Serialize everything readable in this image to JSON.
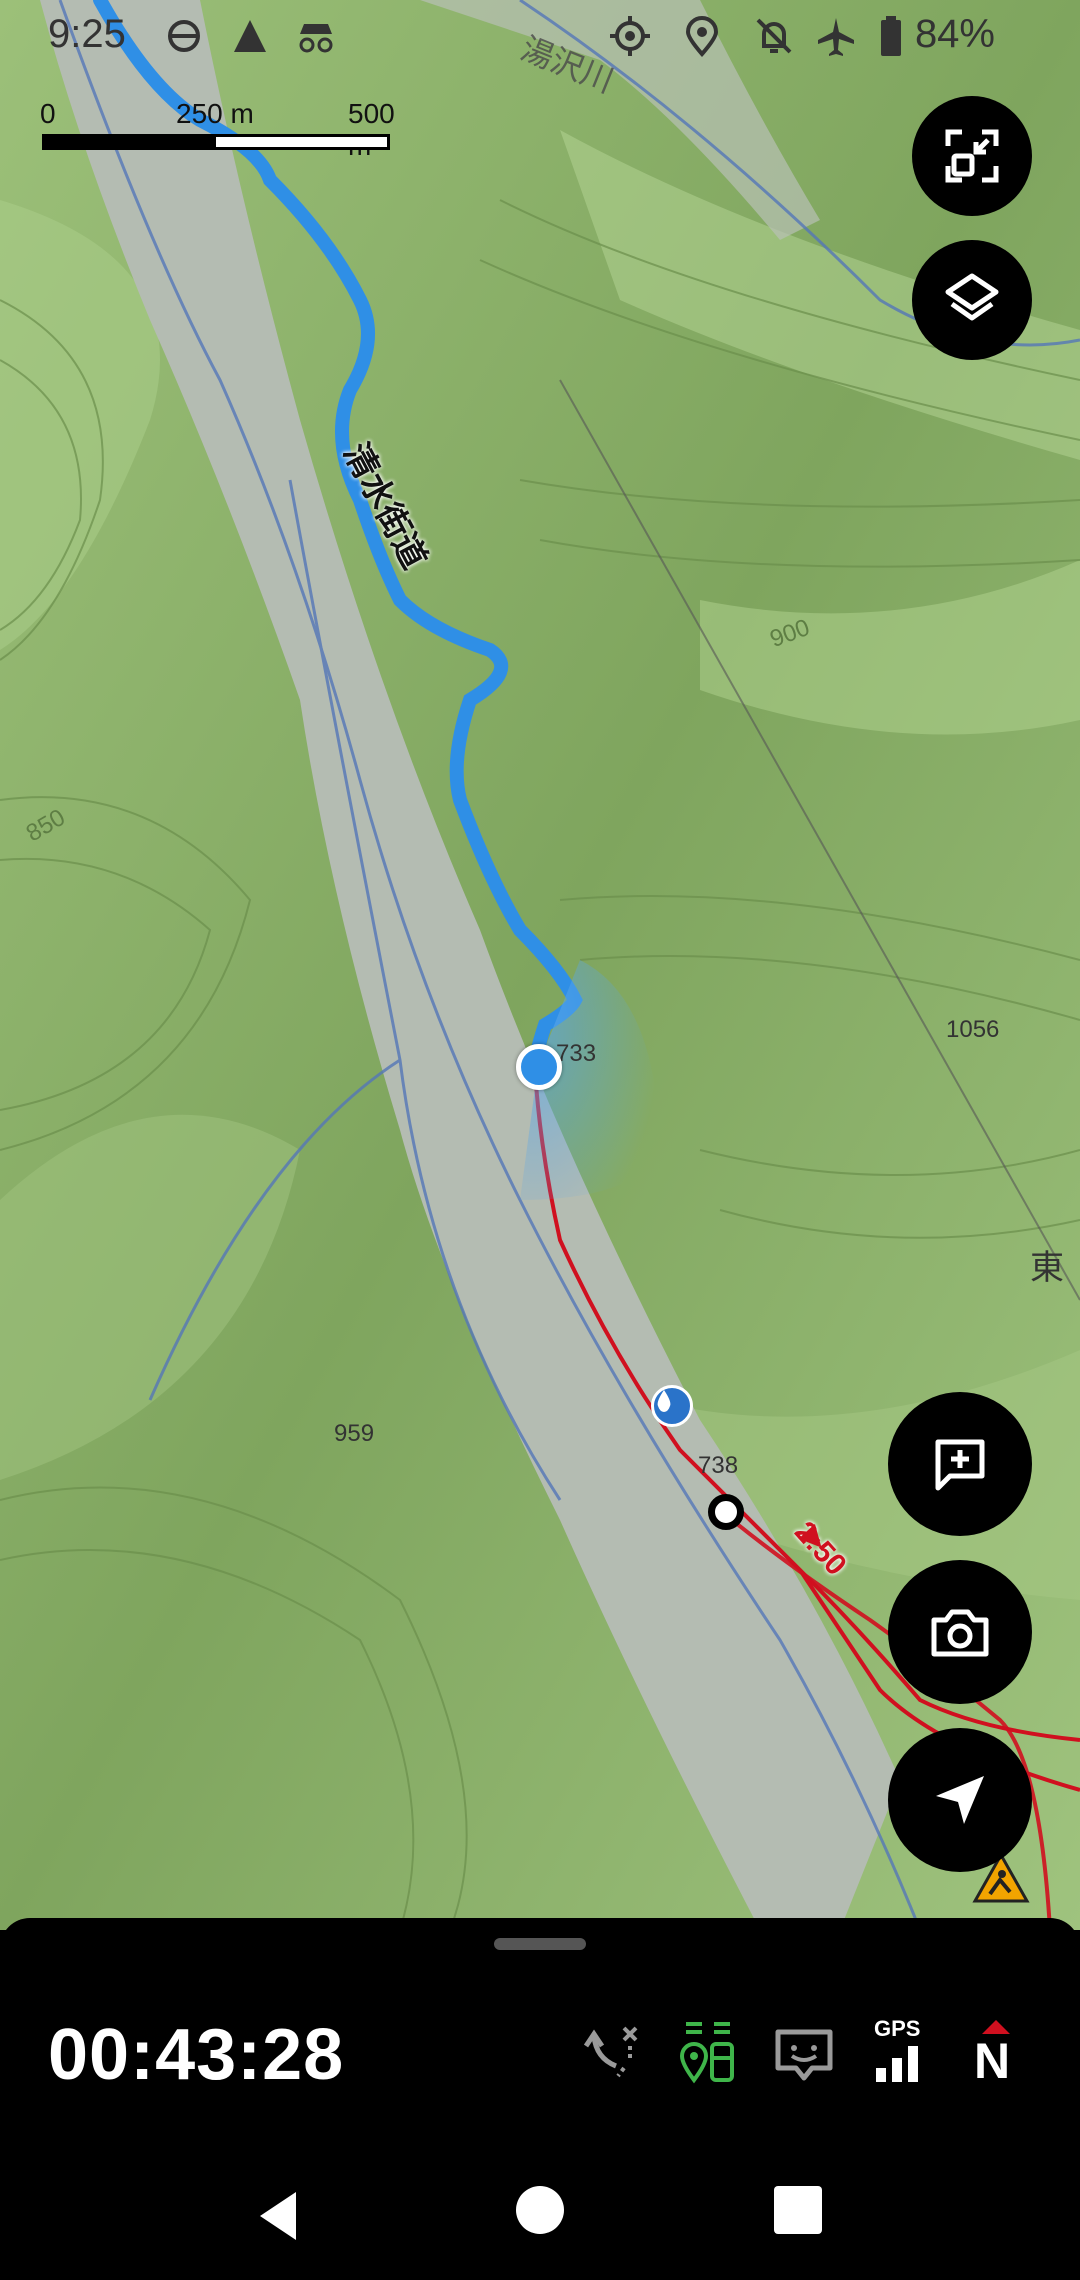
{
  "status_bar": {
    "time": "9:25",
    "battery": "84%",
    "icons": [
      "sync-icon",
      "signal-icon",
      "incognito-icon",
      "location-target-icon",
      "location-pin-icon",
      "notifications-off-icon",
      "airplane-icon",
      "battery-icon"
    ]
  },
  "scale_bar": {
    "label_0": "0",
    "label_mid": "250 m",
    "label_end": "500 m"
  },
  "map": {
    "route_name": "清水街道",
    "river_label": "湯沢川",
    "elevations": [
      "733",
      "1056",
      "959",
      "738",
      "850",
      "900"
    ],
    "place_label": "東",
    "route_time": "2:50",
    "colors": {
      "track": "#2f8fe6",
      "route": "#d0101f",
      "terrain": "#8fb36a",
      "valley": "#b4bcb2"
    }
  },
  "fabs": [
    "fit-screen-button",
    "layers-button",
    "add-note-button",
    "camera-button",
    "navigate-button"
  ],
  "bottom_panel": {
    "timer": "00:43:28",
    "gps_label": "GPS",
    "compass_label": "N",
    "icons": [
      "route-off-icon",
      "waypoints-icon",
      "message-icon",
      "gps-signal-icon",
      "compass-icon"
    ]
  },
  "nav_bar": [
    "back-button",
    "home-button",
    "recents-button"
  ]
}
